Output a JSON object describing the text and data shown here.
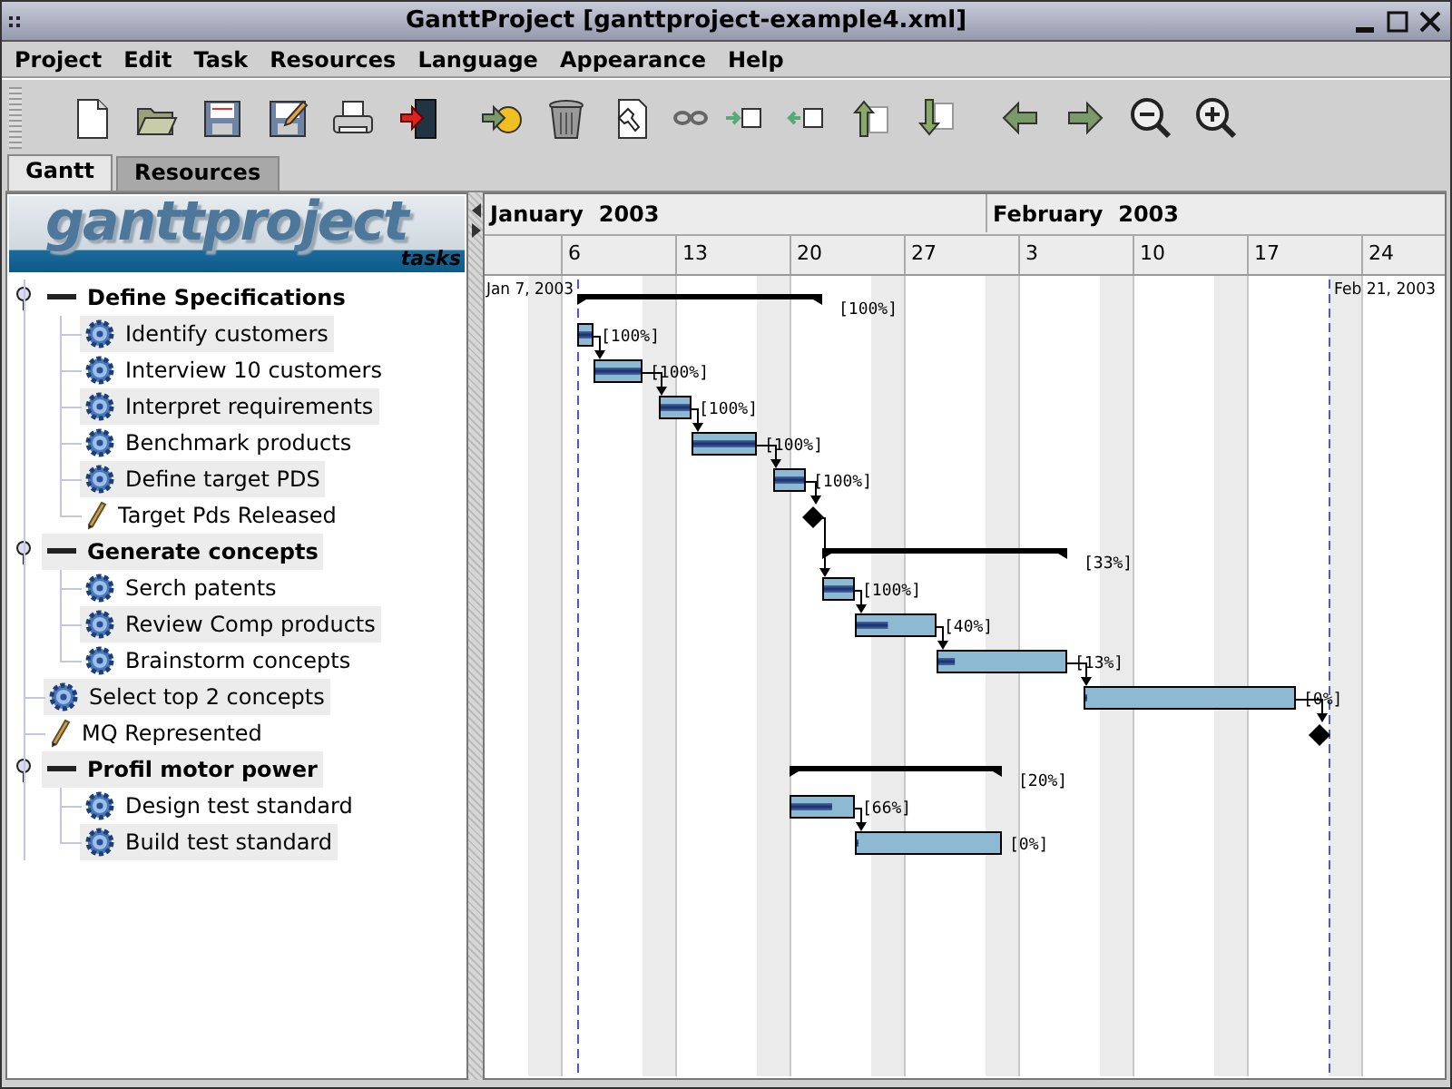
{
  "window": {
    "title": "GanttProject [ganttproject-example4.xml]"
  },
  "menu": [
    "Project",
    "Edit",
    "Task",
    "Resources",
    "Language",
    "Appearance",
    "Help"
  ],
  "tabs": [
    {
      "label": "Gantt",
      "selected": true
    },
    {
      "label": "Resources",
      "selected": false
    }
  ],
  "logo": {
    "title": "ganttproject",
    "subtitle": "tasks"
  },
  "timeline": {
    "months": [
      "January  2003",
      "February  2003"
    ],
    "weeks": [
      "6",
      "13",
      "20",
      "27",
      "3",
      "10",
      "17",
      "24"
    ],
    "markers": [
      {
        "label": "Jan 7, 2003",
        "kind": "start"
      },
      {
        "label": "Feb 21, 2003",
        "kind": "end"
      }
    ]
  },
  "tasks": [
    {
      "name": "Define Specifications",
      "kind": "summary",
      "expanded": true,
      "percent": "[100%]",
      "children": [
        {
          "name": "Identify customers",
          "kind": "task",
          "level": 1,
          "percent": "[100%]"
        },
        {
          "name": "Interview 10 customers",
          "kind": "task",
          "level": 1,
          "percent": "[100%]",
          "after_previous": true
        },
        {
          "name": "Interpret requirements",
          "kind": "task",
          "level": 1,
          "percent": "[100%]",
          "after_previous": true
        },
        {
          "name": "Benchmark products",
          "kind": "task",
          "level": 1,
          "percent": "[100%]",
          "after_previous": true
        },
        {
          "name": "Define target PDS",
          "kind": "task",
          "level": 1,
          "percent": "[100%]",
          "after_previous": true
        },
        {
          "name": "Target Pds Released",
          "kind": "milestone",
          "after_previous": true
        }
      ]
    },
    {
      "name": "Generate concepts",
      "kind": "summary",
      "expanded": true,
      "percent": "[33%]",
      "children": [
        {
          "name": "Serch patents",
          "kind": "task",
          "level": 1,
          "percent": "[100%]",
          "after_previous": true
        },
        {
          "name": "Review Comp products",
          "kind": "task",
          "level": 0.4,
          "percent": "[40%]",
          "after_previous": true
        },
        {
          "name": "Brainstorm concepts",
          "kind": "task",
          "level": 0.13,
          "percent": "[13%]",
          "after_previous": true
        }
      ]
    },
    {
      "name": "Select top 2 concepts",
      "kind": "task",
      "level": 0,
      "percent": "[0%]",
      "after_previous": true
    },
    {
      "name": "MQ Represented",
      "kind": "milestone",
      "after_previous": true
    },
    {
      "name": "Profil motor power",
      "kind": "summary",
      "expanded": true,
      "percent": "[20%]",
      "children": [
        {
          "name": "Design test standard",
          "kind": "task",
          "level": 0.66,
          "percent": "[66%]",
          "after_previous": false
        },
        {
          "name": "Build test standard",
          "kind": "task",
          "level": 0,
          "percent": "[0%]",
          "after_previous": true
        }
      ]
    }
  ]
}
